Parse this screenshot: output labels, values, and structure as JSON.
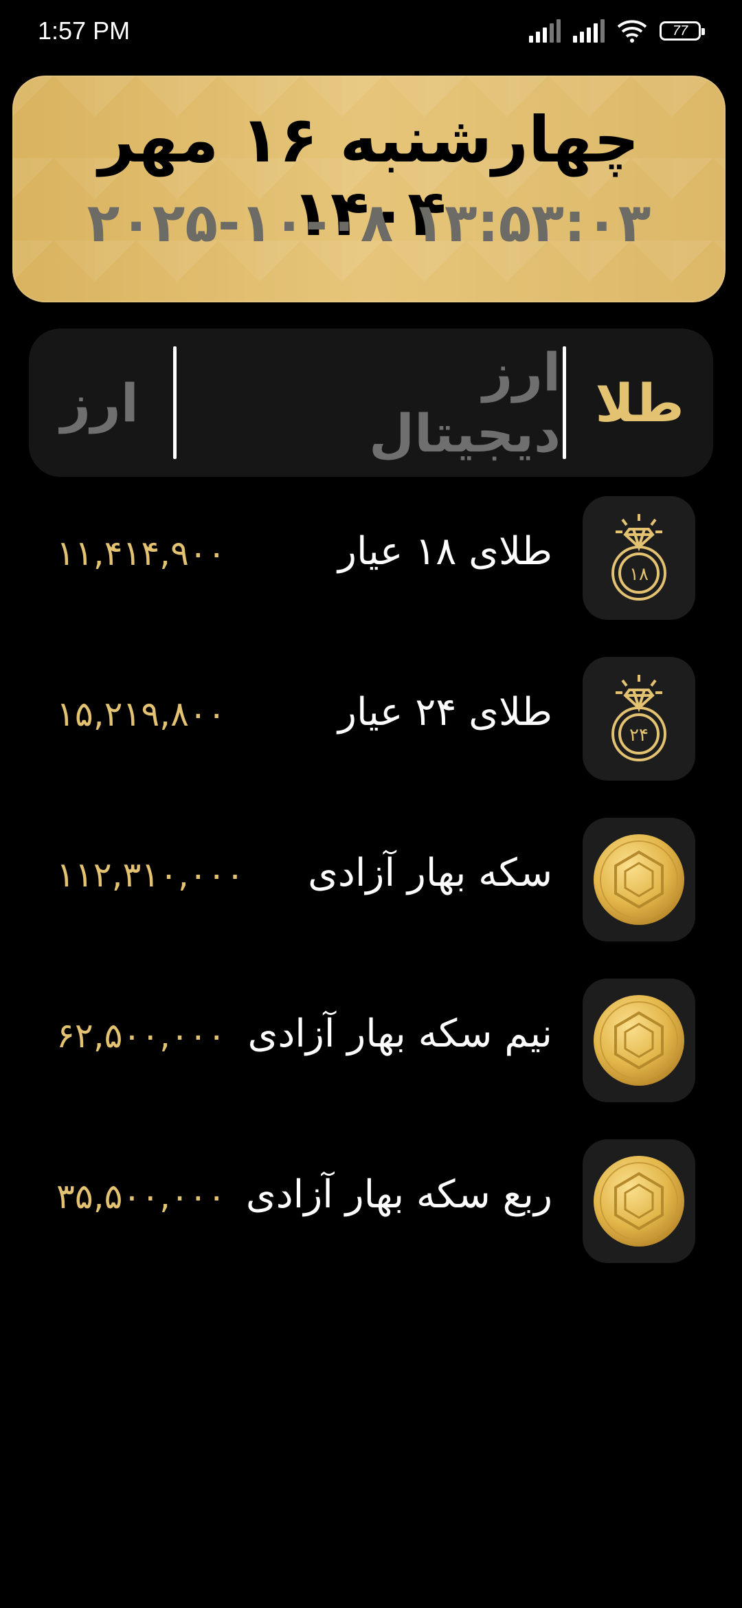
{
  "status_bar": {
    "time": "1:57 PM",
    "battery": "77",
    "icons": [
      "signal-icon",
      "signal-icon",
      "wifi-icon",
      "battery-icon"
    ]
  },
  "header": {
    "persian_date": "چهارشنبه ۱۶ مهر ۱۴۰۴",
    "gregorian_datetime": "۲۰۲۵-۱۰-۰۸ ۱۳:۵۳:۰۳"
  },
  "tabs": {
    "gold": "طلا",
    "crypto": "ارز دیجیتال",
    "currency": "ارز",
    "active": "gold"
  },
  "items": [
    {
      "name": "طلای ۱۸ عیار",
      "price": "۱۱,۴۱۴,۹۰۰",
      "icon": "gold-ring-18-icon",
      "badge": "۱۸"
    },
    {
      "name": "طلای ۲۴ عیار",
      "price": "۱۵,۲۱۹,۸۰۰",
      "icon": "gold-ring-24-icon",
      "badge": "۲۴"
    },
    {
      "name": "سکه بهار آزادی",
      "price": "۱۱۲,۳۱۰,۰۰۰",
      "icon": "gold-coin-icon"
    },
    {
      "name": "نیم سکه بهار آزادی",
      "price": "۶۲,۵۰۰,۰۰۰",
      "icon": "gold-coin-icon"
    },
    {
      "name": "ربع سکه بهار آزادی",
      "price": "۳۵,۵۰۰,۰۰۰",
      "icon": "gold-coin-icon"
    }
  ],
  "colors": {
    "background": "#000000",
    "gold_accent": "#e3c271",
    "card_gold": "#ddb868",
    "tile": "#1d1d1d",
    "muted": "#6f6f6f"
  }
}
